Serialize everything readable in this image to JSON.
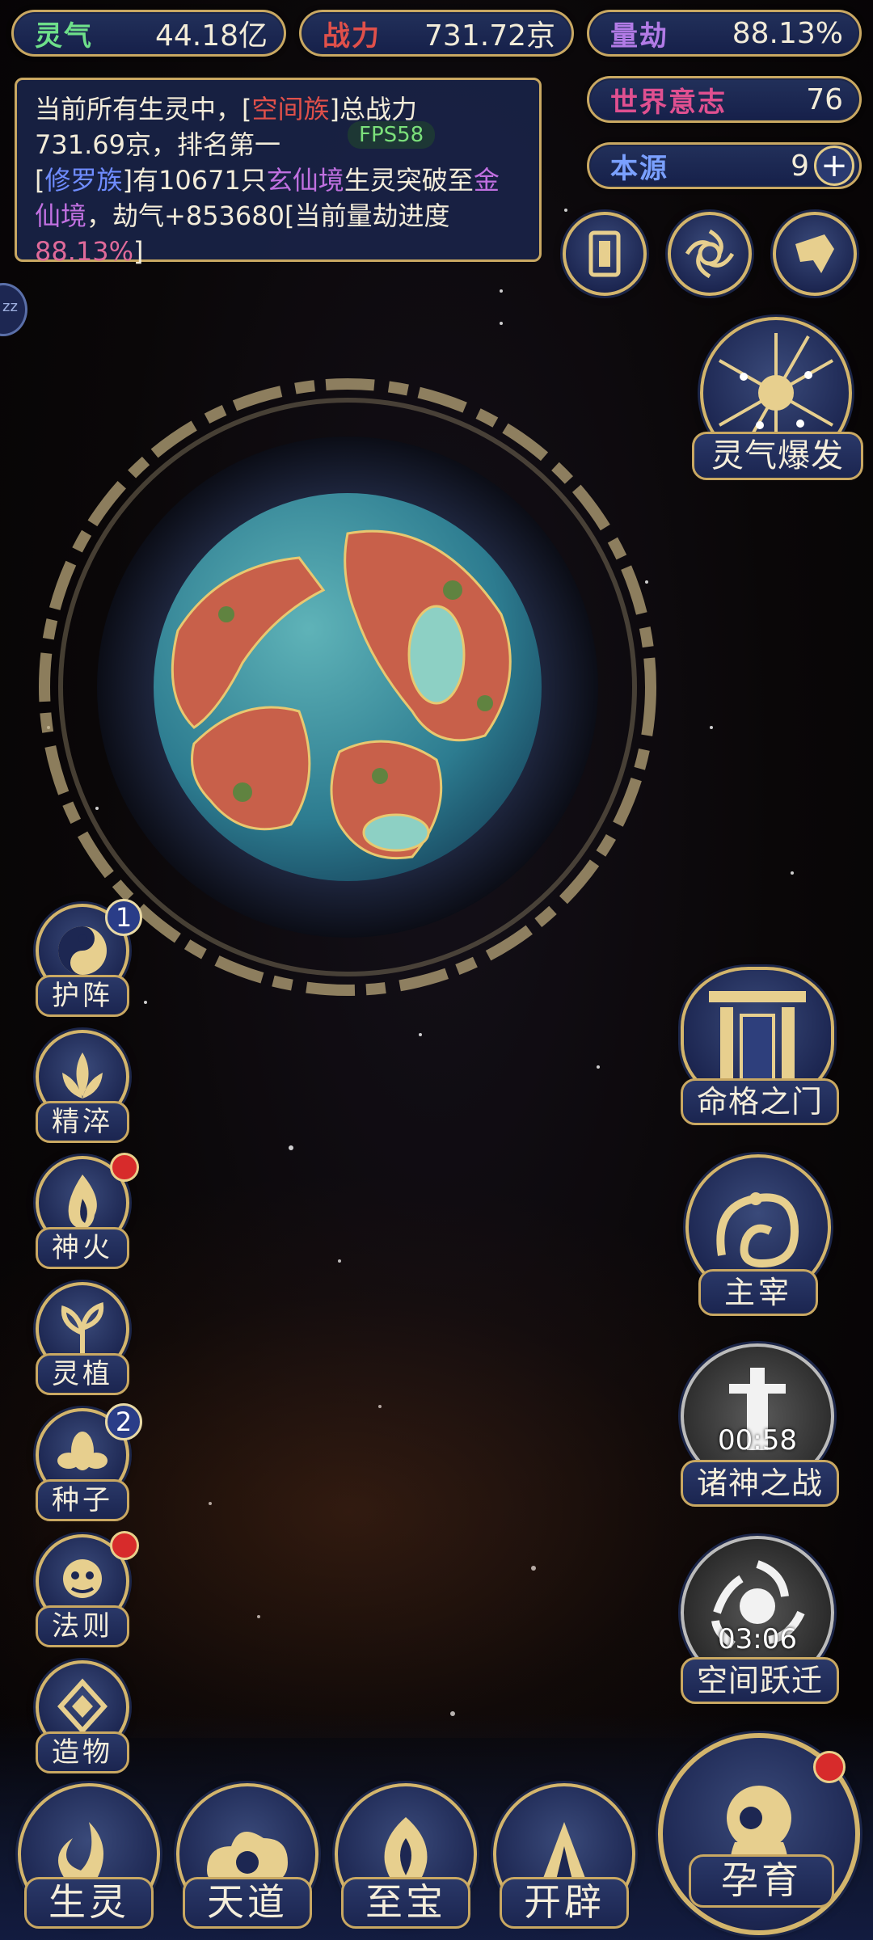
{
  "stats": {
    "lingqi": {
      "label": "灵气",
      "value": "44.18亿",
      "color": "#6ee08a"
    },
    "zhanli": {
      "label": "战力",
      "value": "731.72京",
      "color": "#e0504a"
    },
    "liangjie": {
      "label": "量劫",
      "value": "88.13%",
      "color": "#b27be6"
    },
    "shijie_yizhi": {
      "label": "世界意志",
      "value": "76",
      "color": "#e05090"
    },
    "benyuan": {
      "label": "本源",
      "value": "9",
      "color": "#7aa0ff"
    }
  },
  "message": {
    "line1_pre": "当前所有生灵中，[",
    "line1_race": "空间族",
    "line1_post": "]总战力",
    "line2": "731.69京，排名第一",
    "line3_pre": "[",
    "line3_race": "修罗族",
    "line3_mid": "]有10671只",
    "line3_realm": "玄仙境",
    "line3_post": "生灵突破至",
    "line3_realm2a": "金",
    "line4_realm2b": "仙境",
    "line4_post": "，劫气+853680[当前量劫进度",
    "line5_pct": "88.13%",
    "line5_post": "]",
    "colors": {
      "race_red": "#e0504a",
      "race_blue": "#6f8cff",
      "realm_purple": "#c070e0",
      "pct_pink": "#e06a9a"
    }
  },
  "fps": "FPS58",
  "top_icons": [
    "card-icon",
    "vortex-icon",
    "scroll-icon"
  ],
  "burst": {
    "label": "灵气爆发"
  },
  "left_buttons": [
    {
      "label": "护阵",
      "badge": "1",
      "badge_type": "number",
      "icon": "yin-yang-icon"
    },
    {
      "label": "精淬",
      "badge": "",
      "badge_type": "none",
      "icon": "lotus-icon"
    },
    {
      "label": "神火",
      "badge": "",
      "badge_type": "red",
      "icon": "flame-icon"
    },
    {
      "label": "灵植",
      "badge": "",
      "badge_type": "none",
      "icon": "plant-icon"
    },
    {
      "label": "种子",
      "badge": "2",
      "badge_type": "number",
      "icon": "seed-icon"
    },
    {
      "label": "法则",
      "badge": "",
      "badge_type": "red",
      "icon": "law-beast-icon"
    },
    {
      "label": "造物",
      "badge": "",
      "badge_type": "none",
      "icon": "crystal-icon"
    }
  ],
  "right_buttons": [
    {
      "label": "命格之门",
      "timer": "",
      "icon": "gate-icon"
    },
    {
      "label": "主宰",
      "timer": "",
      "icon": "dragon-icon"
    },
    {
      "label": "诸神之战",
      "timer": "00:58",
      "icon": "sword-icon"
    },
    {
      "label": "空间跃迁",
      "timer": "03:06",
      "icon": "portal-icon"
    }
  ],
  "bottom_nav": [
    {
      "label": "生灵",
      "icon": "phoenix-icon"
    },
    {
      "label": "天道",
      "icon": "cloud-icon"
    },
    {
      "label": "至宝",
      "icon": "treasure-icon"
    },
    {
      "label": "开辟",
      "icon": "axe-icon"
    }
  ],
  "yunyu": {
    "label": "孕育"
  },
  "side_tab": "zz"
}
